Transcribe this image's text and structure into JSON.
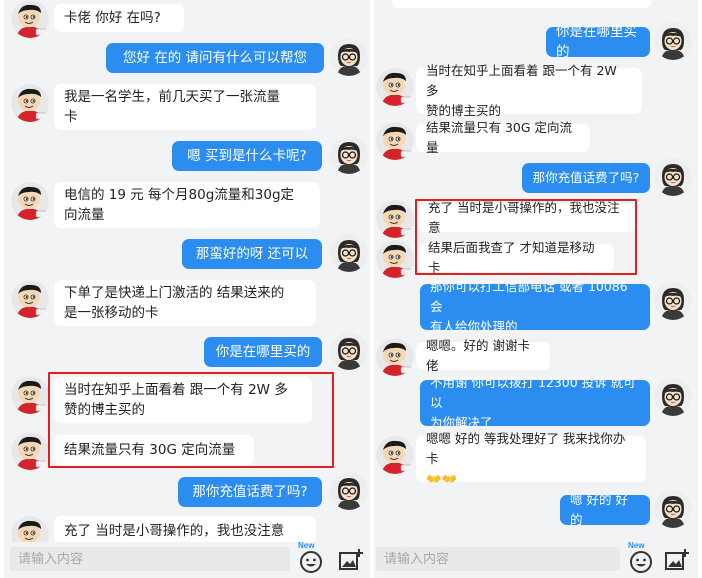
{
  "left_panel": {
    "messages": [
      {
        "side": "recv",
        "text": "卡佬 你好 在吗?"
      },
      {
        "side": "sent",
        "text": "您好 在的 请问有什么可以帮您"
      },
      {
        "side": "recv",
        "lines": [
          "我是一名学生，前几天买了一张流量",
          "卡"
        ]
      },
      {
        "side": "sent",
        "text": "嗯 买到是什么卡呢?"
      },
      {
        "side": "recv",
        "lines": [
          "电信的 19 元 每个月80g流量和30g定",
          "向流量"
        ]
      },
      {
        "side": "sent",
        "text": "那蛮好的呀  还可以"
      },
      {
        "side": "recv",
        "lines": [
          "下单了是快递上门激活的 结果送来的",
          "是一张移动的卡"
        ]
      },
      {
        "side": "sent",
        "text": "你是在哪里买的"
      },
      {
        "side": "recv",
        "lines": [
          "当时在知乎上面看着 跟一个有 2W 多",
          "赞的博主买的"
        ]
      },
      {
        "side": "recv",
        "text": "结果流量只有 30G 定向流量"
      },
      {
        "side": "sent",
        "text": "那你充值话费了吗?"
      },
      {
        "side": "recv",
        "text": "充了 当时是小哥操作的，我也没注意"
      }
    ],
    "input_placeholder": "请输入内容",
    "new_badge": "New"
  },
  "right_panel": {
    "messages": [
      {
        "side": "sent",
        "text": "你是在哪里买的"
      },
      {
        "side": "recv",
        "lines": [
          "当时在知乎上面看着 跟一个有 2W 多",
          "赞的博主买的"
        ]
      },
      {
        "side": "recv",
        "text": "结果流量只有 30G 定向流量"
      },
      {
        "side": "sent",
        "text": "那你充值话费了吗?"
      },
      {
        "side": "recv",
        "text": "充了 当时是小哥操作的，我也没注意"
      },
      {
        "side": "recv",
        "text": "结果后面我查了 才知道是移动卡"
      },
      {
        "side": "sent",
        "lines": [
          "那你可以打工信部电话 或者 10086 会",
          "有人给你处理的"
        ]
      },
      {
        "side": "recv",
        "text": "嗯嗯。好的 谢谢卡佬"
      },
      {
        "side": "sent",
        "lines": [
          "不用谢 你可以拨打 12300 投诉 就可以",
          "为你解决了"
        ]
      },
      {
        "side": "recv",
        "lines": [
          "嗯嗯 好的 等我处理好了 我来找你办卡",
          "👐👐"
        ]
      },
      {
        "side": "sent",
        "text": "嗯 好的  好的"
      }
    ],
    "input_placeholder": "请输入内容",
    "new_badge": "New"
  },
  "colors": {
    "sent_bubble": "#2b8df0",
    "recv_bubble": "#ffffff",
    "chat_bg": "#f2f3f5",
    "highlight_box": "#e02020"
  },
  "icons": {
    "customer_avatar": "cartoon-boy-avatar-icon",
    "agent_avatar": "glasses-person-avatar-icon",
    "emoji_button": "smiley-face-icon",
    "image_button": "image-plus-icon"
  }
}
